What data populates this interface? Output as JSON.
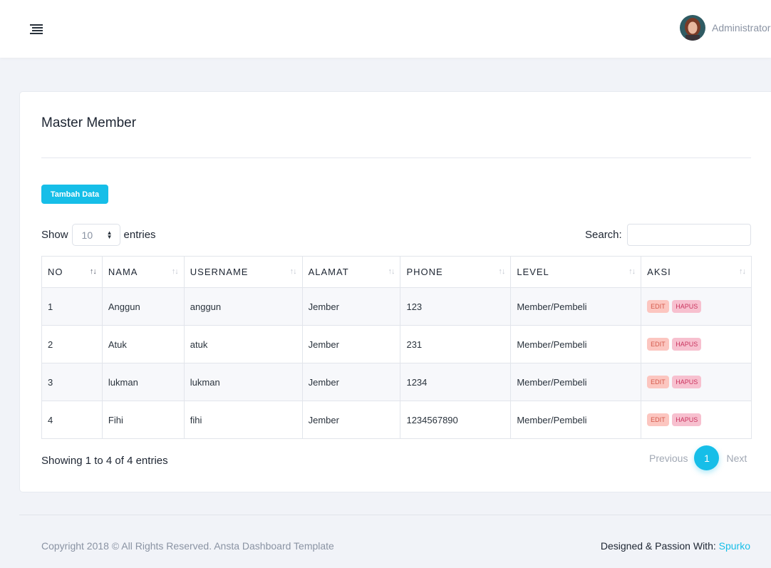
{
  "header": {
    "user_name": "Administrator"
  },
  "card": {
    "title": "Master Member",
    "add_button": "Tambah Data"
  },
  "length_control": {
    "show": "Show",
    "value": "10",
    "entries": "entries"
  },
  "search": {
    "label": "Search:",
    "value": ""
  },
  "table": {
    "columns": [
      "NO",
      "NAMA",
      "USERNAME",
      "ALAMAT",
      "PHONE",
      "LEVEL",
      "AKSI"
    ],
    "rows": [
      {
        "no": "1",
        "nama": "Anggun",
        "username": "anggun",
        "alamat": "Jember",
        "phone": "123",
        "level": "Member/Pembeli"
      },
      {
        "no": "2",
        "nama": "Atuk",
        "username": "atuk",
        "alamat": "Jember",
        "phone": "231",
        "level": "Member/Pembeli"
      },
      {
        "no": "3",
        "nama": "lukman",
        "username": "lukman",
        "alamat": "Jember",
        "phone": "1234",
        "level": "Member/Pembeli"
      },
      {
        "no": "4",
        "nama": "Fihi",
        "username": "fihi",
        "alamat": "Jember",
        "phone": "1234567890",
        "level": "Member/Pembeli"
      }
    ],
    "edit_label": "EDIT",
    "delete_label": "HAPUS"
  },
  "info": "Showing 1 to 4 of 4 entries",
  "pagination": {
    "previous": "Previous",
    "current": "1",
    "next": "Next"
  },
  "footer": {
    "copyright": "Copyright 2018 © All Rights Reserved. Ansta Dashboard Template",
    "designed": "Designed & Passion With:",
    "brand": "Spurko"
  },
  "colors": {
    "accent": "#16bee8",
    "edit_badge": "#fcc6c0",
    "delete_badge": "#f7c0cf"
  }
}
